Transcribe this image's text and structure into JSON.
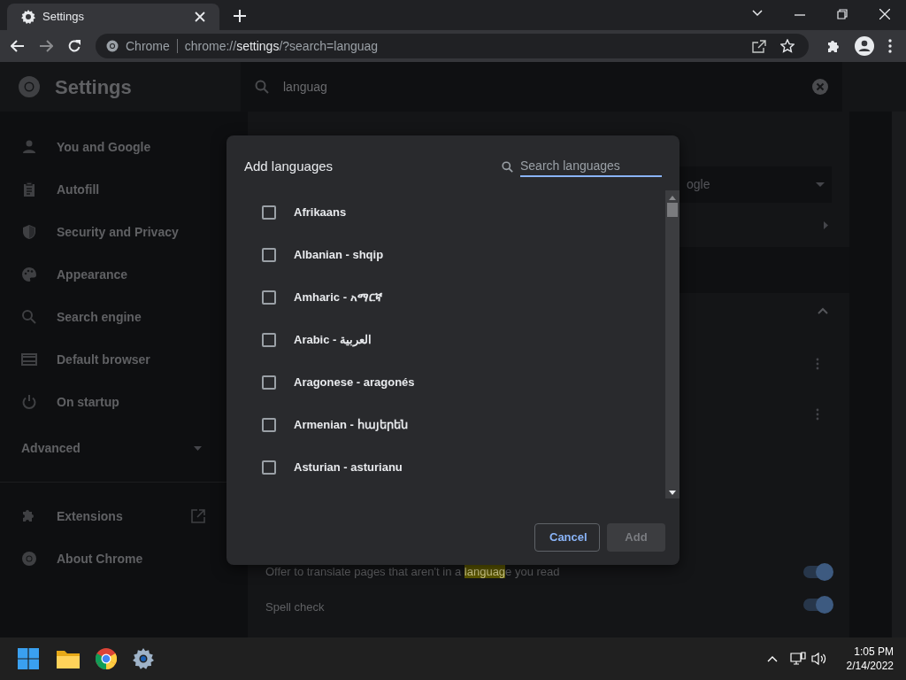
{
  "browser": {
    "tab_title": "Settings",
    "address_origin": "Chrome",
    "url_scheme": "chrome://",
    "url_host": "settings",
    "url_path": "/?search=languag"
  },
  "settings_header": {
    "title": "Settings",
    "search_value": "languag"
  },
  "sidebar": {
    "items": [
      {
        "label": "You and Google"
      },
      {
        "label": "Autofill"
      },
      {
        "label": "Security and Privacy"
      },
      {
        "label": "Appearance"
      },
      {
        "label": "Search engine"
      },
      {
        "label": "Default browser"
      },
      {
        "label": "On startup"
      }
    ],
    "advanced": {
      "label": "Advanced",
      "expanded": false
    },
    "links": [
      {
        "label": "Extensions"
      },
      {
        "label": "About Chrome"
      }
    ]
  },
  "background": {
    "dropdown_text": "ogle",
    "rows": [
      {
        "before": "Offer to translate pages that aren't in a ",
        "highlight": "languag",
        "after": "e you read",
        "on": true
      },
      {
        "before": "Spell check",
        "highlight": "",
        "after": "",
        "on": true
      }
    ]
  },
  "dialog": {
    "title": "Add languages",
    "search": {
      "placeholder": "Search languages"
    },
    "languages": [
      {
        "label": "Afrikaans",
        "checked": false
      },
      {
        "label": "Albanian - shqip",
        "checked": false
      },
      {
        "label": "Amharic - አማርኛ",
        "checked": false
      },
      {
        "label": "Arabic - العربية",
        "checked": false
      },
      {
        "label": "Aragonese - aragonés",
        "checked": false
      },
      {
        "label": "Armenian - հայերեն",
        "checked": false
      },
      {
        "label": "Asturian - asturianu",
        "checked": false
      }
    ],
    "buttons": [
      {
        "label": "Cancel",
        "kind": "outline"
      },
      {
        "label": "Add",
        "kind": "primary",
        "disabled": true
      }
    ]
  },
  "taskbar": {
    "time": "1:05 PM",
    "date": "2/14/2022"
  }
}
